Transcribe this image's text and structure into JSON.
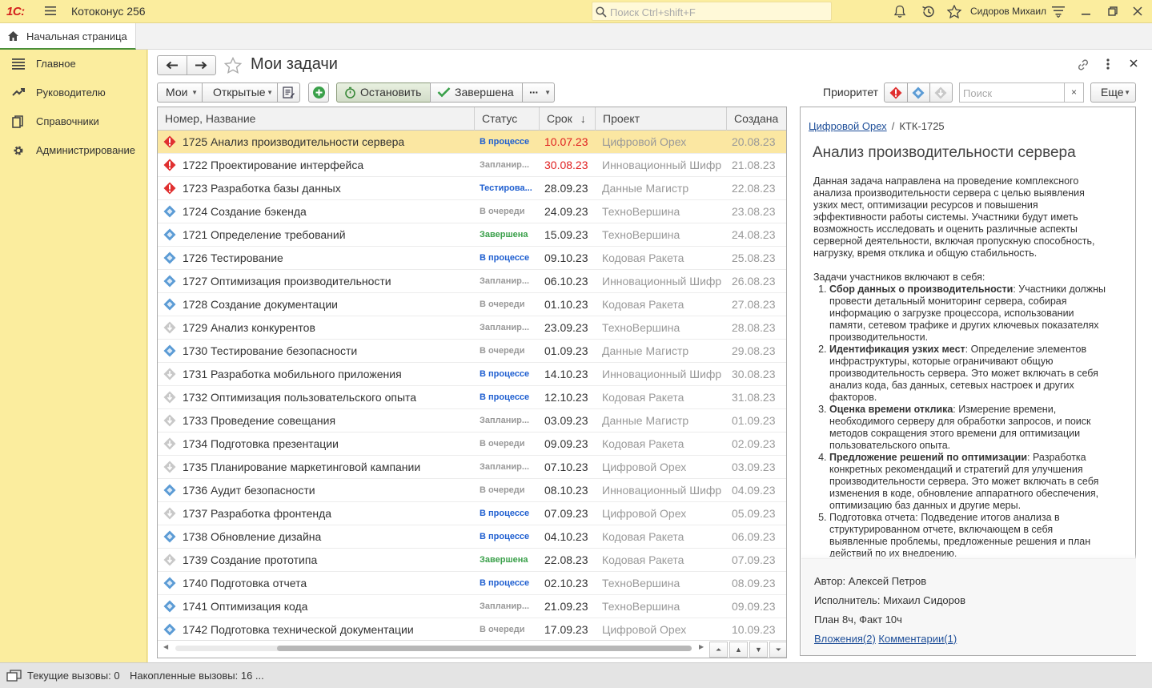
{
  "app": {
    "logo": "1С:",
    "title": "Котоконус 256"
  },
  "topbar": {
    "search_placeholder": "Поиск Ctrl+shift+F",
    "user_name": "Сидоров Михаил"
  },
  "tabs": {
    "home_label": "Начальная страница"
  },
  "sidebar": {
    "items": [
      {
        "label": "Главное",
        "icon": "list-icon"
      },
      {
        "label": "Руководителю",
        "icon": "chart-icon"
      },
      {
        "label": "Справочники",
        "icon": "books-icon"
      },
      {
        "label": "Администрирование",
        "icon": "gear-icon"
      }
    ]
  },
  "page": {
    "title": "Мои задачи"
  },
  "toolbar": {
    "filter_mine": "Мои",
    "filter_open": "Открытые",
    "stop_label": "Остановить",
    "done_label": "Завершена",
    "more_dots": "···",
    "priority_label": "Приоритет",
    "search_placeholder": "Поиск",
    "clear": "×",
    "more_label": "Еще"
  },
  "grid": {
    "columns": [
      "Номер, Название",
      "Статус",
      "Срок",
      "Проект",
      "Создана"
    ],
    "sort_indicator": "↓",
    "rows": [
      {
        "priority": "high",
        "name": "1725 Анализ производительности сервера",
        "status": "В процессе",
        "due": "10.07.23",
        "overdue": true,
        "project": "Цифровой Орех",
        "created": "20.08.23"
      },
      {
        "priority": "high",
        "name": "1722 Проектирование интерфейса",
        "status": "Запланир...",
        "due": "30.08.23",
        "overdue": true,
        "project": "Инновационный Шифр",
        "created": "21.08.23"
      },
      {
        "priority": "high",
        "name": "1723 Разработка базы данных",
        "status": "Тестирова...",
        "due": "28.09.23",
        "overdue": false,
        "project": "Данные Магистр",
        "created": "22.08.23"
      },
      {
        "priority": "medium",
        "name": "1724 Создание бэкенда",
        "status": "В очереди",
        "due": "24.09.23",
        "overdue": false,
        "project": "ТехноВершина",
        "created": "23.08.23"
      },
      {
        "priority": "medium",
        "name": "1721 Определение требований",
        "status": "Завершена",
        "due": "15.09.23",
        "overdue": false,
        "project": "ТехноВершина",
        "created": "24.08.23"
      },
      {
        "priority": "medium",
        "name": "1726 Тестирование",
        "status": "В процессе",
        "due": "09.10.23",
        "overdue": false,
        "project": "Кодовая Ракета",
        "created": "25.08.23"
      },
      {
        "priority": "medium",
        "name": "1727 Оптимизация производительности",
        "status": "Запланир...",
        "due": "06.10.23",
        "overdue": false,
        "project": "Инновационный Шифр",
        "created": "26.08.23"
      },
      {
        "priority": "medium",
        "name": "1728 Создание документации",
        "status": "В очереди",
        "due": "01.10.23",
        "overdue": false,
        "project": "Кодовая Ракета",
        "created": "27.08.23"
      },
      {
        "priority": "low",
        "name": "1729 Анализ конкурентов",
        "status": "Запланир...",
        "due": "23.09.23",
        "overdue": false,
        "project": "ТехноВершина",
        "created": "28.08.23"
      },
      {
        "priority": "medium",
        "name": "1730 Тестирование безопасности",
        "status": "В очереди",
        "due": "01.09.23",
        "overdue": false,
        "project": "Данные Магистр",
        "created": "29.08.23"
      },
      {
        "priority": "low",
        "name": "1731 Разработка мобильного приложения",
        "status": "В процессе",
        "due": "14.10.23",
        "overdue": false,
        "project": "Инновационный Шифр",
        "created": "30.08.23"
      },
      {
        "priority": "low",
        "name": "1732 Оптимизация пользовательского опыта",
        "status": "В процессе",
        "due": "12.10.23",
        "overdue": false,
        "project": "Кодовая Ракета",
        "created": "31.08.23"
      },
      {
        "priority": "low",
        "name": "1733 Проведение совещания",
        "status": "Запланир...",
        "due": "03.09.23",
        "overdue": false,
        "project": "Данные Магистр",
        "created": "01.09.23"
      },
      {
        "priority": "low",
        "name": "1734 Подготовка презентации",
        "status": "В очереди",
        "due": "09.09.23",
        "overdue": false,
        "project": "Кодовая Ракета",
        "created": "02.09.23"
      },
      {
        "priority": "low",
        "name": "1735 Планирование маркетинговой кампании",
        "status": "Запланир...",
        "due": "07.10.23",
        "overdue": false,
        "project": "Цифровой Орех",
        "created": "03.09.23"
      },
      {
        "priority": "medium",
        "name": "1736 Аудит безопасности",
        "status": "В очереди",
        "due": "08.10.23",
        "overdue": false,
        "project": "Инновационный Шифр",
        "created": "04.09.23"
      },
      {
        "priority": "low",
        "name": "1737 Разработка фронтенда",
        "status": "В процессе",
        "due": "07.09.23",
        "overdue": false,
        "project": "Цифровой Орех",
        "created": "05.09.23"
      },
      {
        "priority": "medium",
        "name": "1738 Обновление дизайна",
        "status": "В процессе",
        "due": "04.10.23",
        "overdue": false,
        "project": "Кодовая Ракета",
        "created": "06.09.23"
      },
      {
        "priority": "low",
        "name": "1739 Создание прототипа",
        "status": "Завершена",
        "due": "22.08.23",
        "overdue": false,
        "project": "Кодовая Ракета",
        "created": "07.09.23"
      },
      {
        "priority": "medium",
        "name": "1740 Подготовка отчета",
        "status": "В процессе",
        "due": "02.10.23",
        "overdue": false,
        "project": "ТехноВершина",
        "created": "08.09.23"
      },
      {
        "priority": "medium",
        "name": "1741 Оптимизация кода",
        "status": "Запланир...",
        "due": "21.09.23",
        "overdue": false,
        "project": "ТехноВершина",
        "created": "09.09.23"
      },
      {
        "priority": "medium",
        "name": "1742 Подготовка технической документации",
        "status": "В очереди",
        "due": "17.09.23",
        "overdue": false,
        "project": "Цифровой Орех",
        "created": "10.09.23"
      }
    ]
  },
  "detail": {
    "project_link": "Цифровой Орех",
    "separator": "/",
    "code": "КТК-1725",
    "title": "Анализ производительности сервера",
    "intro": "Данная задача направлена на проведение комплексного анализа производительности сервера с целью выявления узких мест, оптимизации ресурсов и повышения эффективности работы системы. Участники будут иметь возможность исследовать и оценить различные аспекты серверной деятельности, включая пропускную способность, нагрузку, время отклика и общую стабильность.",
    "tasks_heading": "Задачи участников включают в себя:",
    "tasks": [
      {
        "bold": "Сбор данных о производительности",
        "text": ": Участники должны провести детальный мониторинг сервера, собирая информацию о загрузке процессора, использовании памяти, сетевом трафике и других ключевых показателях производительности."
      },
      {
        "bold": "Идентификация узких мест",
        "text": ": Определение элементов инфраструктуры, которые ограничивают общую производительность сервера. Это может включать в себя анализ кода, баз данных, сетевых настроек и других факторов."
      },
      {
        "bold": "Оценка времени отклика",
        "text": ": Измерение времени, необходимого серверу для обработки запросов, и поиск методов сокращения этого времени для оптимизации пользовательского опыта."
      },
      {
        "bold": "Предложение решений по оптимизации",
        "text": ": Разработка конкретных рекомендаций и стратегий для улучшения производительности сервера. Это может включать в себя изменения в коде, обновление аппаратного обеспечения, оптимизацию баз данных и другие меры."
      },
      {
        "bold": "",
        "text": "Подготовка отчета: Подведение итогов анализа в структурированном отчете, включающем в себя выявленные проблемы, предложенные решения и план действий по их внедрению."
      }
    ],
    "author": "Автор: Алексей Петров",
    "executor": "Исполнитель: Михаил Сидоров",
    "plan_fact": "План 8ч, Факт 10ч",
    "attachments": "Вложения(2)",
    "comments": "Комментарии(1)"
  },
  "statusbar": {
    "current_calls": "Текущие вызовы: 0",
    "accumulated_calls": "Накопленные вызовы: 16 ..."
  },
  "colors": {
    "accent_yellow": "#fbed9e",
    "selected_row": "#fbe7a2",
    "link": "#1f4f99",
    "overdue": "#e02020",
    "status_in_progress": "#1f5fd0",
    "status_done": "#3aa04a",
    "status_muted": "#999999",
    "priority_high": "#e03030",
    "priority_medium": "#5b9bd5",
    "priority_low": "#c8c8c8"
  }
}
